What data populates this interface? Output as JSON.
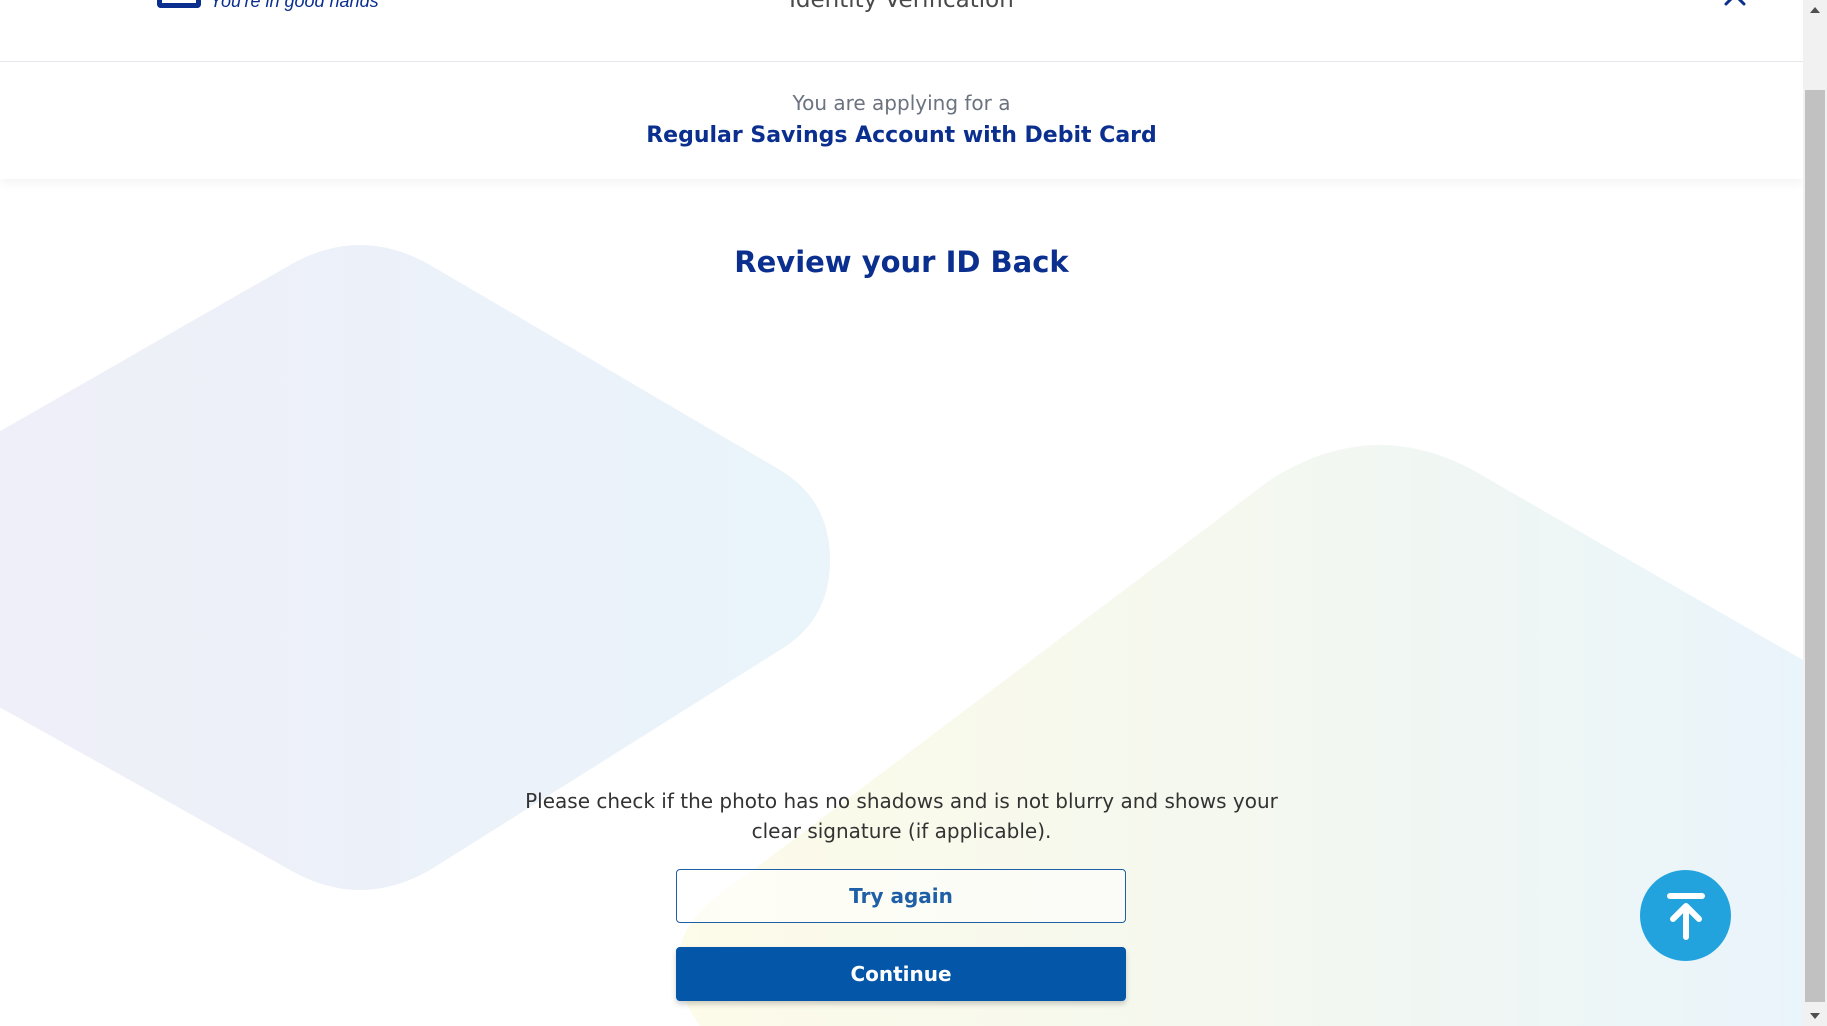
{
  "header": {
    "tagline": "You're in good hands",
    "title": "Identity Verification",
    "close_icon": "close-icon",
    "logo_icon": "logo-icon"
  },
  "banner": {
    "subtitle": "You are applying for a",
    "product": "Regular Savings Account with Debit Card"
  },
  "main": {
    "title": "Review your ID Back",
    "instructions": "Please check if the photo has no shadows and is not blurry and shows your clear signature (if applicable).",
    "try_again_label": "Try again",
    "continue_label": "Continue"
  },
  "fab": {
    "icon": "arrow-up-to-top-icon"
  },
  "colors": {
    "brand_navy": "#0b2f8f",
    "primary_button": "#0456a8",
    "secondary_text": "#1f5fa6",
    "fab": "#22a3de"
  }
}
